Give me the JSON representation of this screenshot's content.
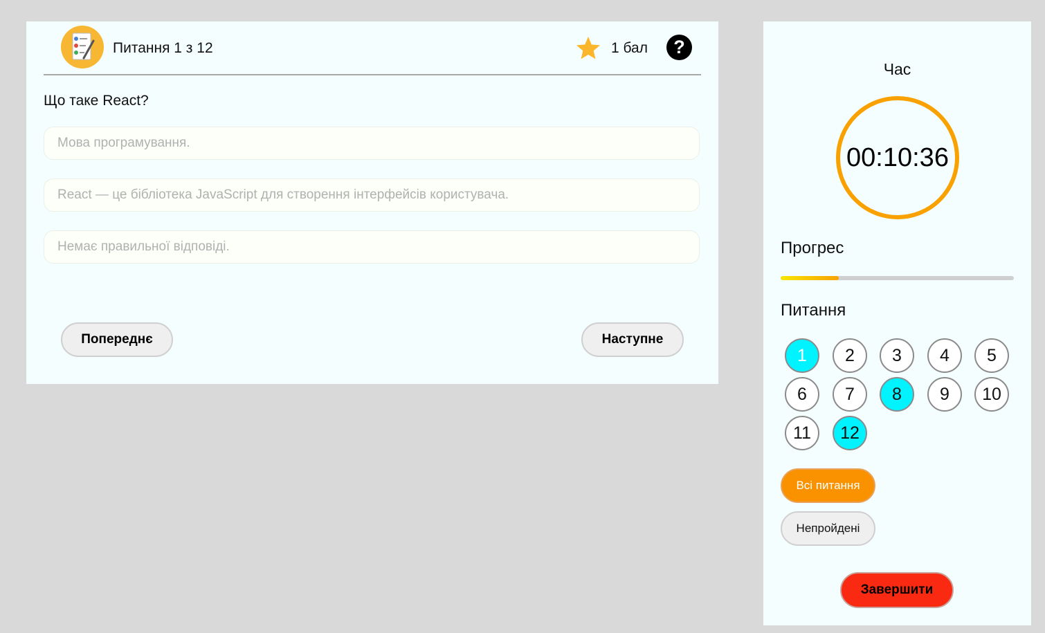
{
  "quiz": {
    "counter": "Питання 1 з 12",
    "score": "1 бал",
    "help_symbol": "?",
    "question": "Що таке React?",
    "answers": [
      "Мова програмування.",
      "React — це бібліотека JavaScript для створення інтерфейсів користувача.",
      "Немає правильної відповіді."
    ],
    "prev_label": "Попереднє",
    "next_label": "Наступне"
  },
  "sidebar": {
    "time_label": "Час",
    "timer": "00:10:36",
    "progress_label": "Прогрес",
    "progress_fraction": 0.25,
    "questions_label": "Питання",
    "questions": [
      {
        "label": "1",
        "answered": true,
        "current": true
      },
      {
        "label": "2",
        "answered": false,
        "current": false
      },
      {
        "label": "3",
        "answered": false,
        "current": false
      },
      {
        "label": "4",
        "answered": false,
        "current": false
      },
      {
        "label": "5",
        "answered": false,
        "current": false
      },
      {
        "label": "6",
        "answered": false,
        "current": false
      },
      {
        "label": "7",
        "answered": false,
        "current": false
      },
      {
        "label": "8",
        "answered": true,
        "current": false
      },
      {
        "label": "9",
        "answered": false,
        "current": false
      },
      {
        "label": "10",
        "answered": false,
        "current": false
      },
      {
        "label": "11",
        "answered": false,
        "current": false
      },
      {
        "label": "12",
        "answered": true,
        "current": false
      }
    ],
    "filter_all_label": "Всі питання",
    "filter_unanswered_label": "Непройдені",
    "finish_label": "Завершити"
  },
  "icons": {
    "logo": "quiz-checklist-icon",
    "score": "star-icon",
    "help": "question-mark-icon"
  },
  "colors": {
    "accent": "#f9a100",
    "answered": "#00f3ff",
    "finish": "#fa2a12",
    "card_bg": "#f4fefe"
  }
}
